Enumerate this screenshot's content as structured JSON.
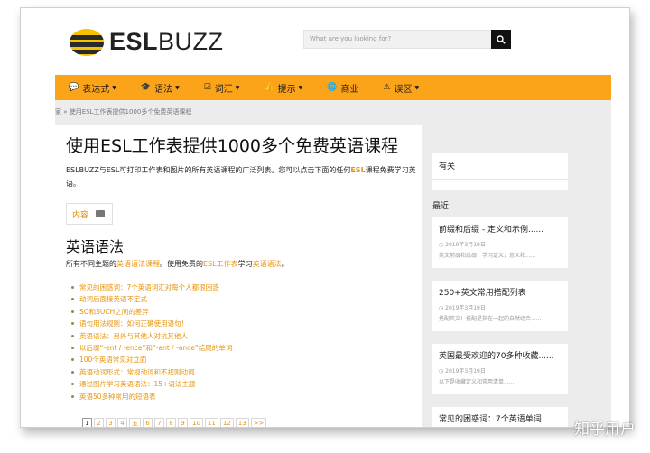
{
  "logo": {
    "part1": "ESL",
    "part2": "BUZZ"
  },
  "search": {
    "placeholder": "What are you looking for?"
  },
  "nav": [
    {
      "icon": "comment-icon",
      "glyph": "💬",
      "label": "表达式"
    },
    {
      "icon": "graduation-cap-icon",
      "glyph": "🎓",
      "label": "语法"
    },
    {
      "icon": "checkbox-icon",
      "glyph": "☑",
      "label": "词汇"
    },
    {
      "icon": "thumbs-up-icon",
      "glyph": "👍",
      "label": "提示"
    },
    {
      "icon": "globe-icon",
      "glyph": "🌐",
      "label": "商业"
    },
    {
      "icon": "warning-icon",
      "glyph": "⚠",
      "label": "误区"
    }
  ],
  "breadcrumb": {
    "home": "家",
    "sep": "»",
    "current": "使用ESL工作表提供1000多个免费英语课程"
  },
  "title": "使用ESL工作表提供1000多个免费英语课程",
  "intro": {
    "before": "ESLBUZZ与ESL可打印工作表和图片的所有英语课程的广泛列表。您可以点击下面的任何",
    "link": "ESL",
    "after": "课程免费学习英语。"
  },
  "toc_label": "内容",
  "section_title": "英语语法",
  "section_sub": {
    "before": "所有不同主题的",
    "link1": "英语语法课程",
    "mid1": "。使用免费的",
    "link2": "ESL工作表",
    "mid2": "学习",
    "link3": "英语语法",
    "after": "。"
  },
  "grammar_links": [
    "常见的困惑词：7个英语词汇对每个人都很困惑",
    "动词后面接英语不定式",
    "SO和SUCH之间的差异",
    "语句用法规则：如何正确使用语句！",
    "英语语法：另外与其他人对抗其他人",
    "以后缀“-ent / -ence”和“-ant / -ance”结尾的单词",
    "100个英语常见对立面",
    "英语动词形式：常规动词和不规则动词",
    "通过图片学习英语语法：15+语法主题",
    "英语50多种常用的短语表"
  ],
  "pagination": [
    "1",
    "2",
    "3",
    "4",
    "五",
    "6",
    "7",
    "8",
    "9",
    "10",
    "11",
    "12",
    "13",
    ">>"
  ],
  "sidebar": {
    "related_heading": "有关",
    "recent_heading": "最近",
    "posts": [
      {
        "title": "前缀和后缀 - 定义和示例......",
        "date": "2019年3月19日",
        "excerpt": "英文前缀和后缀！学习定义，意义和......"
      },
      {
        "title": "250+英文常用搭配列表",
        "date": "2019年3月19日",
        "excerpt": "搭配英文！搭配是指在一起的自然组合......"
      },
      {
        "title": "英国最受欢迎的70多种收藏......",
        "date": "2019年3月19日",
        "excerpt": "以下是收藏定义和常用清单......"
      },
      {
        "title": "常见的困惑词：7个英语单词",
        "date": "",
        "excerpt": ""
      }
    ]
  },
  "watermark": "知乎用户",
  "colors": {
    "accent": "#fba41a",
    "link": "#e8940c",
    "logo_bee": "#f6c100"
  }
}
